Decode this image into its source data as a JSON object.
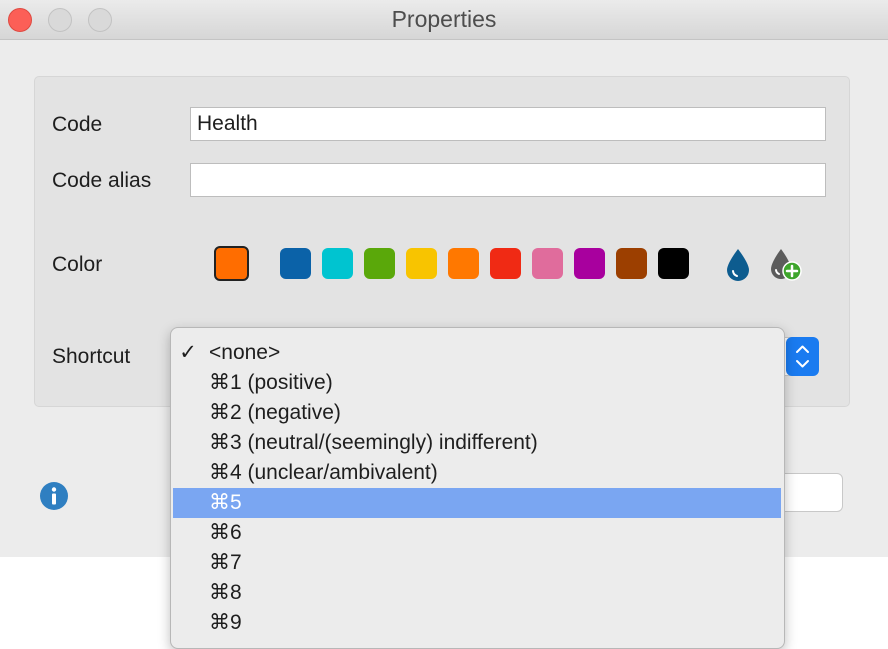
{
  "window": {
    "title": "Properties"
  },
  "form": {
    "code_label": "Code",
    "code_value": "Health",
    "alias_label": "Code alias",
    "alias_value": "",
    "color_label": "Color",
    "shortcut_label": "Shortcut"
  },
  "colors": {
    "selected": "#ff6d00",
    "palette": [
      "#0b62a8",
      "#00c4d0",
      "#5aa80a",
      "#f8c400",
      "#ff7800",
      "#f02a14",
      "#e06c9c",
      "#a8009e",
      "#9c3f00",
      "#000000"
    ],
    "drop_icon": "water-drop-icon",
    "add_color_icon": "add-color-icon"
  },
  "shortcut_menu": {
    "selected_index": 0,
    "highlight_index": 5,
    "items": [
      "<none>",
      "⌘1 (positive)",
      "⌘2 (negative)",
      "⌘3 (neutral/(seemingly) indifferent)",
      "⌘4 (unclear/ambivalent)",
      "⌘5",
      "⌘6",
      "⌘7",
      "⌘8",
      "⌘9"
    ],
    "check_glyph": "✓"
  },
  "footer": {
    "info_icon": "info-icon"
  }
}
